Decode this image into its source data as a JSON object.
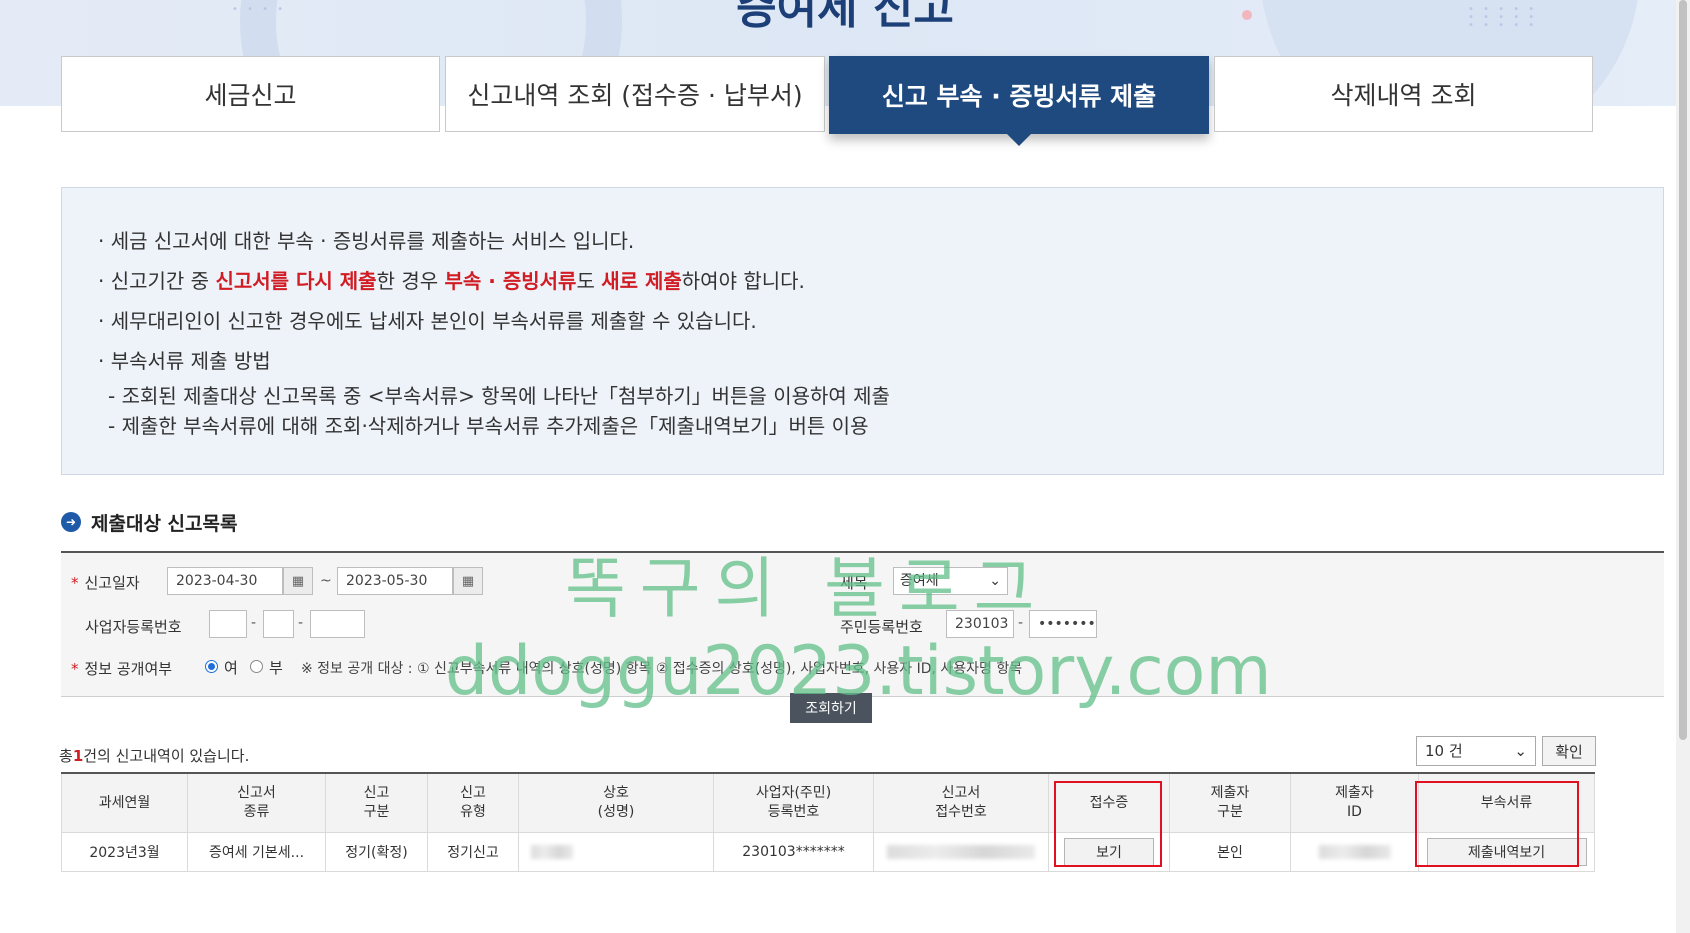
{
  "page": {
    "title": "증여세 신고"
  },
  "tabs": [
    {
      "label": "세금신고"
    },
    {
      "label": "신고내역 조회 (접수증 · 납부서)"
    },
    {
      "label": "신고 부속 · 증빙서류 제출"
    },
    {
      "label": "삭제내역 조회"
    }
  ],
  "info": {
    "line1": "· 세금 신고서에 대한 부속 · 증빙서류를 제출하는 서비스 입니다.",
    "line2": {
      "p1": "· 신고기간 중 ",
      "r1": "신고서를 다시 제출",
      "p2": "한 경우 ",
      "r2": "부속 · 증빙서류",
      "p3": "도 ",
      "r3": "새로 제출",
      "p4": "하여야 합니다."
    },
    "line3": "· 세무대리인이 신고한 경우에도 납세자 본인이 부속서류를 제출할 수 있습니다.",
    "line4": "· 부속서류 제출 방법",
    "sub1": "- 조회된 제출대상 신고목록 중 <부속서류> 항목에 나타난「첨부하기」버튼을 이용하여 제출",
    "sub2": "- 제출한 부속서류에 대해 조회·삭제하거나 부속서류 추가제출은「제출내역보기」버튼 이용"
  },
  "section": {
    "title": "제출대상 신고목록"
  },
  "search": {
    "date_label": "신고일자",
    "date_from": "2023-04-30",
    "date_to": "2023-05-30",
    "date_sep": "~",
    "tax_label": "세목",
    "tax_value": "증여세",
    "bizno_label": "사업자등록번호",
    "jumin_label": "주민등록번호",
    "jumin_front": "230103",
    "jumin_back": "•••••••",
    "dash": "-",
    "disclose_label": "정보 공개여부",
    "opt_yes": "여",
    "opt_no": "부",
    "notice": "※ 정보 공개 대상 : ① 신고부속서류 내역의 상호(성명) 항목 ② 접수증의 상호(성명), 사업자번호, 사용자 ID, 사용자명 항목",
    "button": "조회하기"
  },
  "results": {
    "total_prefix": "총",
    "total_count": "1",
    "total_suffix": "건의 신고내역이 있습니다.",
    "page_size": "10 건",
    "confirm": "확인"
  },
  "table": {
    "headers": [
      "과세연월",
      "신고서\n종류",
      "신고\n구분",
      "신고\n유형",
      "상호\n(성명)",
      "사업자(주민)\n등록번호",
      "신고서\n접수번호",
      "접수증",
      "제출자\n구분",
      "제출자\nID",
      "부속서류"
    ],
    "row": {
      "period": "2023년3월",
      "kind": "증여세 기본세...",
      "type": "정기(확정)",
      "filing": "정기신고",
      "regno": "230103*******",
      "receipt_btn": "보기",
      "submitter": "본인",
      "docs_btn": "제출내역보기"
    }
  },
  "watermark": {
    "line1": "똑구의 블로그",
    "line2": "ddoggu2023.tistory.com"
  },
  "colors": {
    "primary": "#1f4a80",
    "accent_red": "#d11c24",
    "highlight": "#e01020",
    "watermark": "#61c08a"
  }
}
